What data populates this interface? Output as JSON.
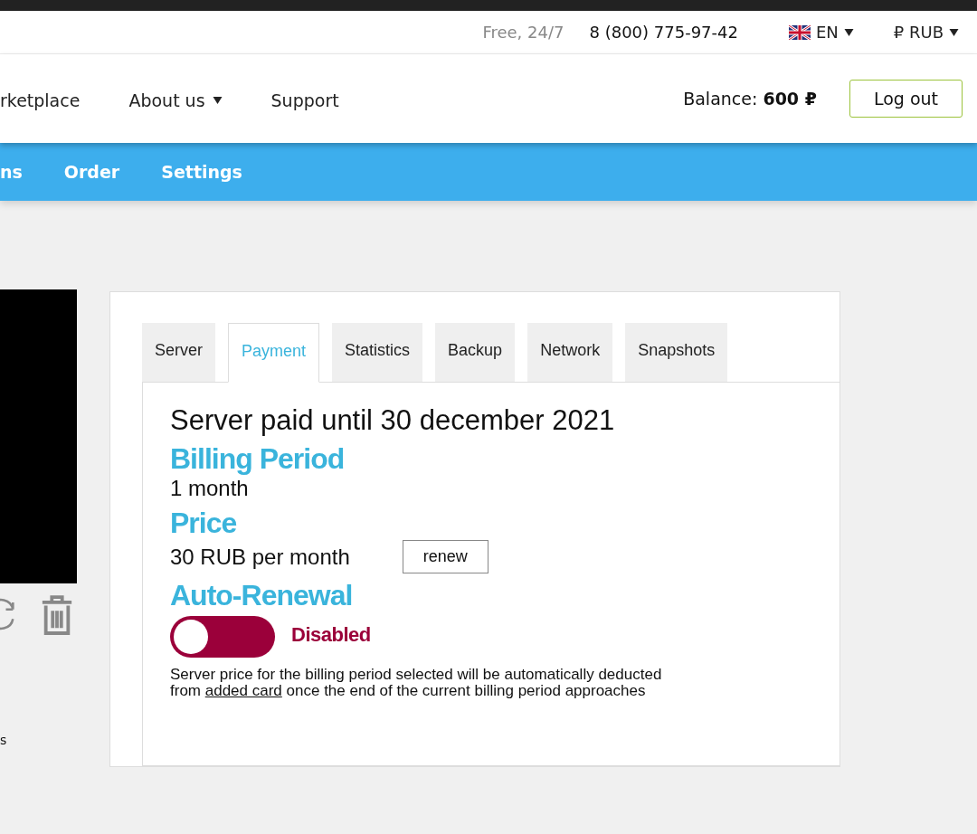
{
  "top_bar": {
    "hours": "Free, 24/7",
    "phone": "8 (800) 775-97-42",
    "language": "EN",
    "currency": "₽ RUB"
  },
  "nav": {
    "items": [
      {
        "label": "rketplace",
        "dropdown": false
      },
      {
        "label": "About us",
        "dropdown": true
      },
      {
        "label": "Support",
        "dropdown": false
      }
    ],
    "balance_label": "Balance:",
    "balance_value": "600 ₽",
    "logout": "Log out"
  },
  "subnav": {
    "items": [
      "ns",
      "Order",
      "Settings"
    ]
  },
  "left_panel": {
    "fragment": "s"
  },
  "tabs": [
    {
      "label": "Server",
      "selected": false
    },
    {
      "label": "Payment",
      "selected": true
    },
    {
      "label": "Statistics",
      "selected": false
    },
    {
      "label": "Backup",
      "selected": false
    },
    {
      "label": "Network",
      "selected": false
    },
    {
      "label": "Snapshots",
      "selected": false
    }
  ],
  "payment": {
    "paid_until": "Server paid until 30 december 2021",
    "billing_heading": "Billing Period",
    "billing_value": "1 month",
    "price_heading": "Price",
    "price_value": "30 RUB per month",
    "renew": "renew",
    "auto_heading": "Auto-Renewal",
    "auto_renewal": {
      "on": false,
      "status": "Disabled"
    },
    "note_before": "Server price for the billing period selected will be automatically deducted from",
    "note_link": "added card",
    "note_after": "once the end of the current billing period approaches"
  }
}
